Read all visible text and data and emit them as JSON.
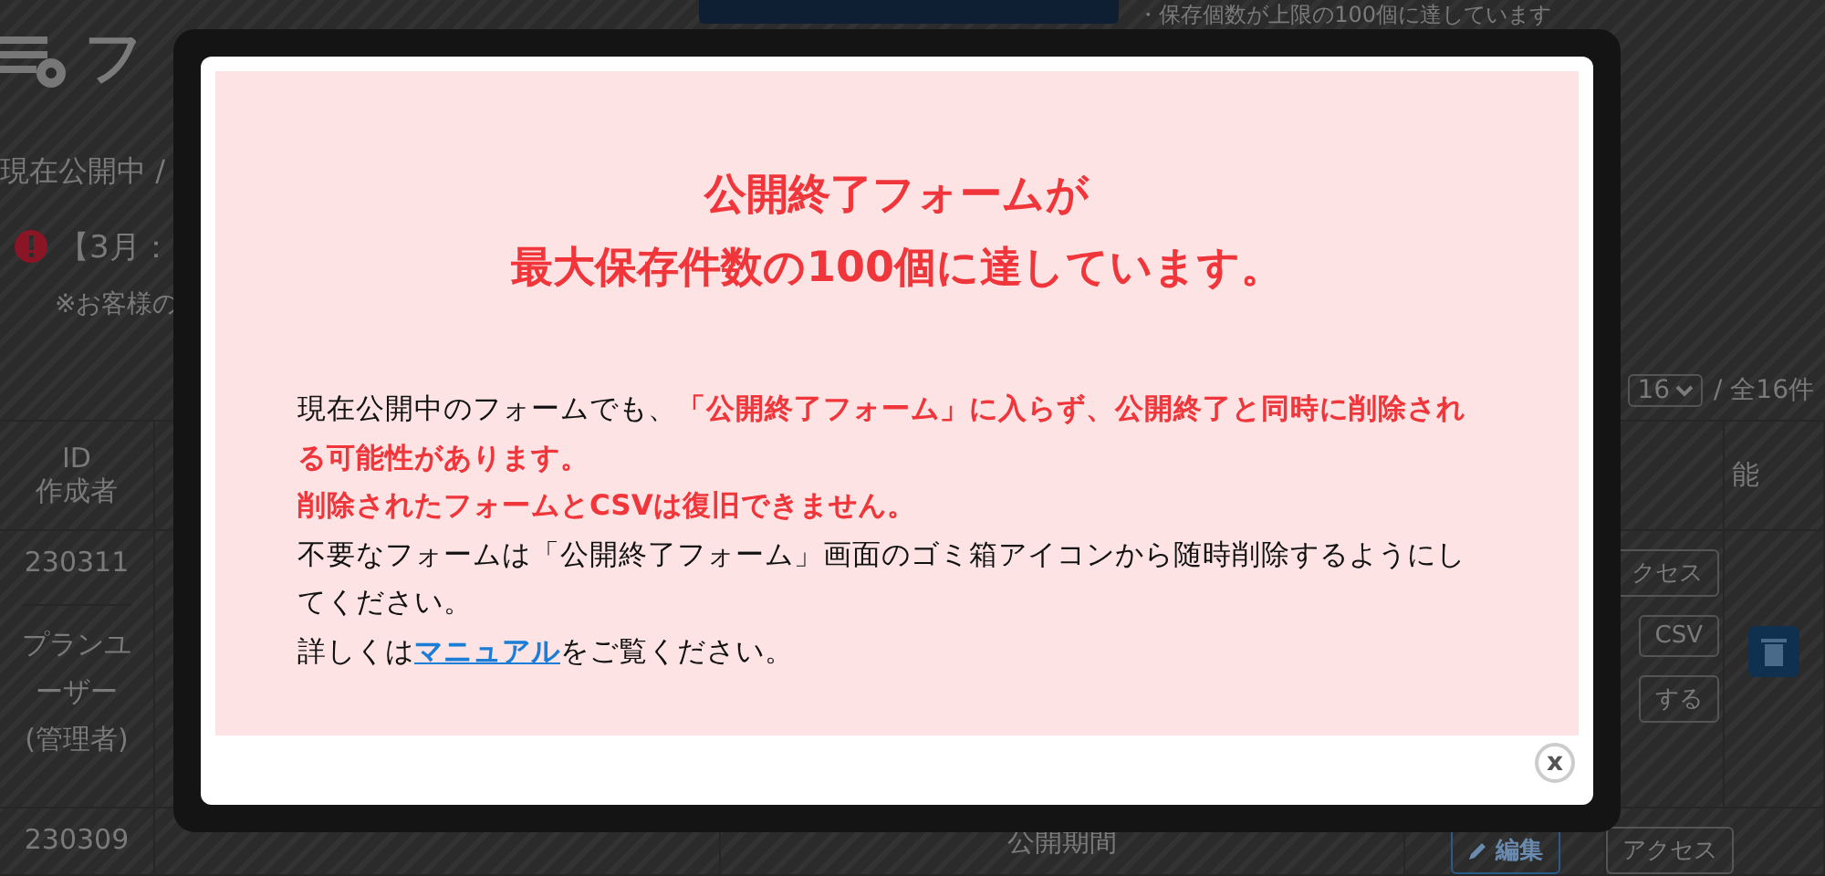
{
  "page": {
    "title": "フ",
    "banner": "・保存個数が上限の100個に達しています",
    "breadcrumb": "現在公開中 /",
    "notice": "【3月：",
    "note": "※お客様の",
    "toolbar": {
      "per_page": "16",
      "total": "/ 全16件"
    },
    "columns": [
      {
        "label": "ID\n作成者"
      },
      {
        "label": "能"
      }
    ],
    "rows": [
      {
        "id": "230311",
        "author": "プランユーザー(管理者)",
        "actions": [
          "クセス",
          "CSV",
          "する"
        ]
      },
      {
        "id": "230309",
        "period": "公開期間",
        "actions": [
          "編集",
          "アクセス"
        ]
      }
    ]
  },
  "modal": {
    "title": [
      "公開終了フォームが",
      "最大保存件数の100個に達しています。"
    ],
    "paragraphs": [
      {
        "kind": "text",
        "text": "現在公開中のフォームでも、**「公開終了フォーム」に入らず、公開終了と同時に削除される可能性があります。**"
      },
      {
        "kind": "warning",
        "text": "削除されたフォームとCSVは復旧できません。"
      },
      {
        "kind": "text",
        "text": "不要なフォームは「公開終了フォーム」画面のゴミ箱アイコンから随時削除するようにしてください。"
      },
      {
        "kind": "link",
        "before": "詳しくは",
        "link": "マニュアル",
        "after": "をご覧ください。"
      }
    ],
    "close": "x"
  }
}
